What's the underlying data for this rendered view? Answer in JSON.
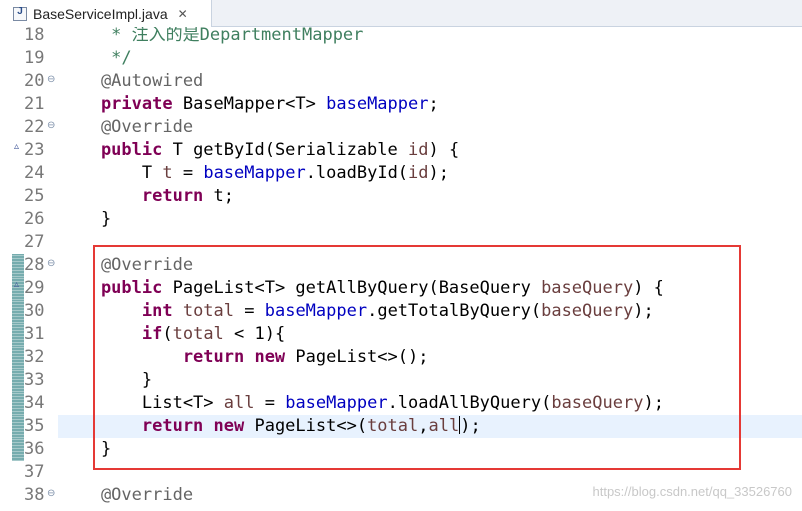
{
  "tab": {
    "title": "BaseServiceImpl.java",
    "close": "✕",
    "icon": "java-file-icon"
  },
  "watermark": "https://blog.csdn.net/qq_33526760",
  "lines": [
    {
      "n": "18",
      "tokens": [
        [
          "cmt",
          "     * 注入的是DepartmentMapper"
        ]
      ]
    },
    {
      "n": "19",
      "tokens": [
        [
          "cmt",
          "     */"
        ]
      ]
    },
    {
      "n": "20",
      "fold": "⊖",
      "tokens": [
        [
          "ann",
          "    @Autowired"
        ]
      ]
    },
    {
      "n": "21",
      "tokens": [
        [
          "kw",
          "    private "
        ],
        [
          "pl",
          "BaseMapper<T> "
        ],
        [
          "fld",
          "baseMapper"
        ],
        [
          "pl",
          ";"
        ]
      ]
    },
    {
      "n": "22",
      "fold": "⊖",
      "tokens": [
        [
          "ann",
          "    @Override"
        ]
      ]
    },
    {
      "n": "23",
      "override": "▵",
      "tokens": [
        [
          "kw",
          "    public "
        ],
        [
          "pl",
          "T getById(Serializable "
        ],
        [
          "var",
          "id"
        ],
        [
          "pl",
          ") {"
        ]
      ]
    },
    {
      "n": "24",
      "tokens": [
        [
          "pl",
          "        T "
        ],
        [
          "var",
          "t"
        ],
        [
          "pl",
          " = "
        ],
        [
          "fld",
          "baseMapper"
        ],
        [
          "pl",
          ".loadById("
        ],
        [
          "var",
          "id"
        ],
        [
          "pl",
          ");"
        ]
      ]
    },
    {
      "n": "25",
      "tokens": [
        [
          "kw",
          "        return "
        ],
        [
          "pl",
          "t;"
        ]
      ]
    },
    {
      "n": "26",
      "tokens": [
        [
          "pl",
          "    }"
        ]
      ]
    },
    {
      "n": "27",
      "tokens": []
    },
    {
      "n": "28",
      "fold": "⊖",
      "mark": true,
      "tokens": [
        [
          "ann",
          "    @Override"
        ]
      ]
    },
    {
      "n": "29",
      "override": "▵",
      "mark": true,
      "tokens": [
        [
          "kw",
          "    public "
        ],
        [
          "pl",
          "PageList<T> getAllByQuery(BaseQuery "
        ],
        [
          "var",
          "baseQuery"
        ],
        [
          "pl",
          ") {"
        ]
      ]
    },
    {
      "n": "30",
      "mark": true,
      "tokens": [
        [
          "kw",
          "        int "
        ],
        [
          "var",
          "total"
        ],
        [
          "pl",
          " = "
        ],
        [
          "fld",
          "baseMapper"
        ],
        [
          "pl",
          ".getTotalByQuery("
        ],
        [
          "var",
          "baseQuery"
        ],
        [
          "pl",
          ");"
        ]
      ]
    },
    {
      "n": "31",
      "mark": true,
      "tokens": [
        [
          "kw",
          "        if"
        ],
        [
          "pl",
          "("
        ],
        [
          "var",
          "total"
        ],
        [
          "pl",
          " < 1){"
        ]
      ]
    },
    {
      "n": "32",
      "mark": true,
      "tokens": [
        [
          "kw",
          "            return new "
        ],
        [
          "pl",
          "PageList<>();"
        ]
      ]
    },
    {
      "n": "33",
      "mark": true,
      "tokens": [
        [
          "pl",
          "        }"
        ]
      ]
    },
    {
      "n": "34",
      "mark": true,
      "tokens": [
        [
          "pl",
          "        List<T> "
        ],
        [
          "var",
          "all"
        ],
        [
          "pl",
          " = "
        ],
        [
          "fld",
          "baseMapper"
        ],
        [
          "pl",
          ".loadAllByQuery("
        ],
        [
          "var",
          "baseQuery"
        ],
        [
          "pl",
          ");"
        ]
      ]
    },
    {
      "n": "35",
      "mark": true,
      "current": true,
      "tokens": [
        [
          "kw",
          "        return new "
        ],
        [
          "pl",
          "PageList<>("
        ],
        [
          "var",
          "total"
        ],
        [
          "pl",
          ","
        ],
        [
          "var",
          "all"
        ],
        [
          "caret",
          ""
        ],
        [
          "pl",
          ");"
        ]
      ]
    },
    {
      "n": "36",
      "mark": true,
      "tokens": [
        [
          "pl",
          "    }"
        ]
      ]
    },
    {
      "n": "37",
      "tokens": []
    },
    {
      "n": "38",
      "fold": "⊖",
      "tokens": [
        [
          "ann",
          "    @Override"
        ]
      ]
    }
  ]
}
